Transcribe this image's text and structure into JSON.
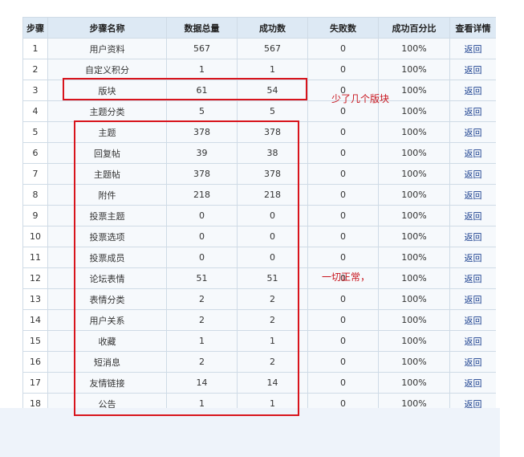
{
  "columns": [
    "步骤",
    "步骤名称",
    "数据总量",
    "成功数",
    "失败数",
    "成功百分比",
    "查看详情"
  ],
  "link_label": "返回",
  "rows": [
    {
      "step": "1",
      "name": "用户资料",
      "total": "567",
      "success": "567",
      "fail": "0",
      "percent": "100%"
    },
    {
      "step": "2",
      "name": "自定义积分",
      "total": "1",
      "success": "1",
      "fail": "0",
      "percent": "100%"
    },
    {
      "step": "3",
      "name": "版块",
      "total": "61",
      "success": "54",
      "fail": "0",
      "percent": "100%"
    },
    {
      "step": "4",
      "name": "主题分类",
      "total": "5",
      "success": "5",
      "fail": "0",
      "percent": "100%"
    },
    {
      "step": "5",
      "name": "主题",
      "total": "378",
      "success": "378",
      "fail": "0",
      "percent": "100%"
    },
    {
      "step": "6",
      "name": "回复帖",
      "total": "39",
      "success": "38",
      "fail": "0",
      "percent": "100%"
    },
    {
      "step": "7",
      "name": "主题帖",
      "total": "378",
      "success": "378",
      "fail": "0",
      "percent": "100%"
    },
    {
      "step": "8",
      "name": "附件",
      "total": "218",
      "success": "218",
      "fail": "0",
      "percent": "100%"
    },
    {
      "step": "9",
      "name": "投票主题",
      "total": "0",
      "success": "0",
      "fail": "0",
      "percent": "100%"
    },
    {
      "step": "10",
      "name": "投票选项",
      "total": "0",
      "success": "0",
      "fail": "0",
      "percent": "100%"
    },
    {
      "step": "11",
      "name": "投票成员",
      "total": "0",
      "success": "0",
      "fail": "0",
      "percent": "100%"
    },
    {
      "step": "12",
      "name": "论坛表情",
      "total": "51",
      "success": "51",
      "fail": "0",
      "percent": "100%"
    },
    {
      "step": "13",
      "name": "表情分类",
      "total": "2",
      "success": "2",
      "fail": "0",
      "percent": "100%"
    },
    {
      "step": "14",
      "name": "用户关系",
      "total": "2",
      "success": "2",
      "fail": "0",
      "percent": "100%"
    },
    {
      "step": "15",
      "name": "收藏",
      "total": "1",
      "success": "1",
      "fail": "0",
      "percent": "100%"
    },
    {
      "step": "16",
      "name": "短消息",
      "total": "2",
      "success": "2",
      "fail": "0",
      "percent": "100%"
    },
    {
      "step": "17",
      "name": "友情链接",
      "total": "14",
      "success": "14",
      "fail": "0",
      "percent": "100%"
    },
    {
      "step": "18",
      "name": "公告",
      "total": "1",
      "success": "1",
      "fail": "0",
      "percent": "100%"
    }
  ],
  "annotations": {
    "note_missing": "少了几个版块",
    "note_normal": "一切正常，"
  },
  "colors": {
    "highlight": "#d8141c",
    "header_bg": "#dde9f4",
    "border": "#cfdbe6",
    "link": "#1a3f8f"
  }
}
